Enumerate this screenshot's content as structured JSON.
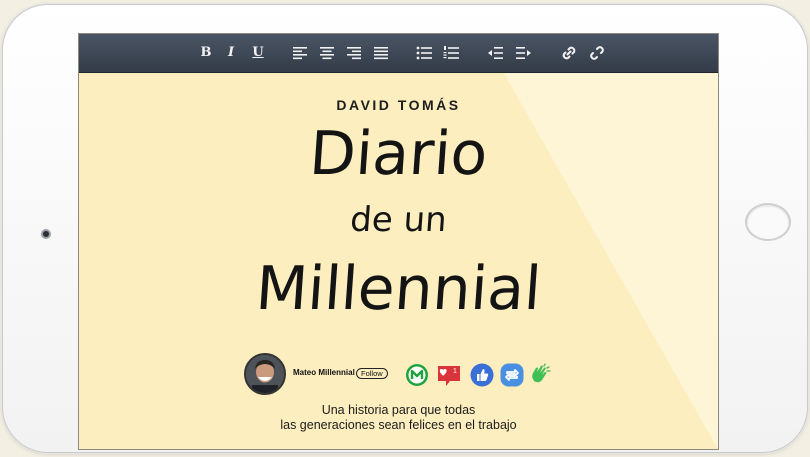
{
  "toolbar": {
    "bold_label": "B",
    "italic_label": "I",
    "underline_label": "U",
    "icons": [
      "align-left-icon",
      "align-center-icon",
      "align-right-icon",
      "align-justify-icon",
      "bullet-list-icon",
      "numbered-list-icon",
      "outdent-icon",
      "indent-icon",
      "link-icon",
      "unlink-icon"
    ]
  },
  "book": {
    "author": "DAVID TOMÁS",
    "title_line1": "Diario",
    "title_line2": "de un",
    "title_line3": "Millennial",
    "caption_line1": "Una historia para que todas",
    "caption_line2": "las generaciones sean felices en el trabajo"
  },
  "profile": {
    "username": "Mateo Millennial",
    "follow_label": "Follow"
  },
  "social": {
    "notification_count": "1",
    "icons": [
      "m-logo-icon",
      "heart-notification-icon",
      "thumbs-up-icon",
      "retweet-icon",
      "clap-icon"
    ]
  },
  "colors": {
    "screen_bg": "#fdeebf",
    "toolbar_bg": "#3c4553",
    "accent_green": "#1ea23c",
    "accent_red": "#d9343a",
    "accent_blue": "#3b6fd8"
  }
}
